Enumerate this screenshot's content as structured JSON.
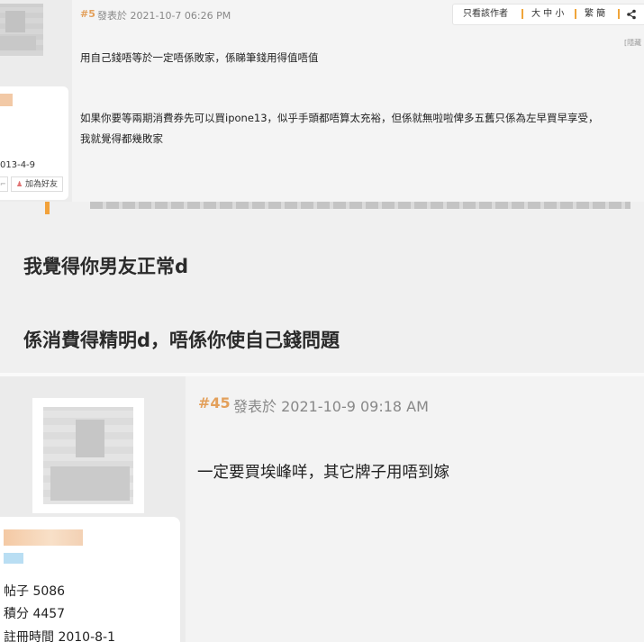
{
  "post5": {
    "number": "#5",
    "posted": "發表於 2021-10-7 06:26 PM",
    "toolbar": {
      "author_only": "只看該作者",
      "font_size": "大 中 小",
      "script": "繁 簡",
      "share_icon": "share-icon"
    },
    "hidden_label": "[隱藏",
    "lines": [
      "用自己錢唔等於一定唔係敗家，係睇筆錢用得值唔值",
      "如果你要等兩期消費券先可以買ipone13，似乎手頭都唔算太充裕，但係就無啦啦俾多五舊只係為左早買早享受，",
      "我就覺得都幾敗家"
    ],
    "user": {
      "reg_date": "013-4-9",
      "add_friend": "加為好友"
    }
  },
  "quote": {
    "lines": [
      "我覺得你男友正常d",
      "係消費得精明d，唔係你使自己錢問題"
    ]
  },
  "post45": {
    "number": "#45",
    "posted": "發表於 2021-10-9 09:18 AM",
    "line": "一定要買埃峰咩，其它牌子用唔到嫁",
    "user": {
      "posts": "帖子  5086",
      "points": "積分  4457",
      "reg": "註冊時間   2010-8-1"
    }
  },
  "colors": {
    "accent": "#f0a53a",
    "post_number": "#e3a05b"
  }
}
